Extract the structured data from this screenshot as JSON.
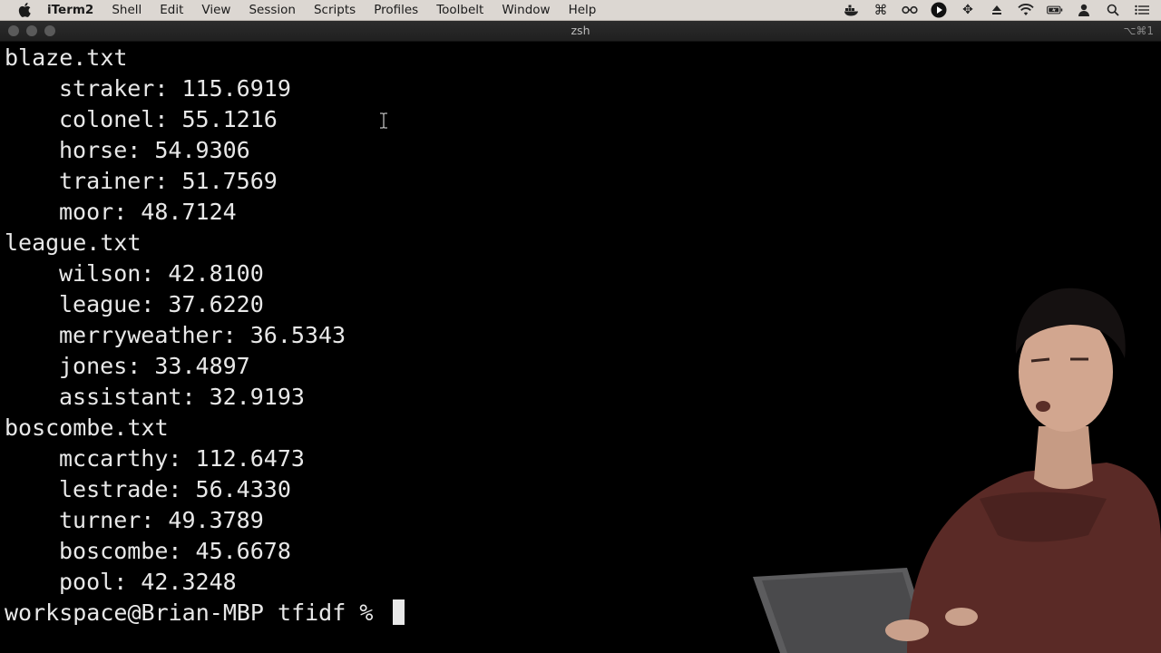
{
  "menubar": {
    "app_name": "iTerm2",
    "items": [
      "Shell",
      "Edit",
      "View",
      "Session",
      "Scripts",
      "Profiles",
      "Toolbelt",
      "Window",
      "Help"
    ],
    "status_icons": [
      "docker-icon",
      "command-icon",
      "glasses-icon",
      "play-icon",
      "move-icon",
      "eject-icon",
      "wifi-icon",
      "battery-icon",
      "user-icon",
      "search-icon",
      "list-icon"
    ]
  },
  "window": {
    "title": "zsh",
    "shortcut": "⌥⌘1"
  },
  "terminal": {
    "groups": [
      {
        "file": "blaze.txt",
        "entries": [
          "straker: 115.6919",
          "colonel: 55.1216",
          "horse: 54.9306",
          "trainer: 51.7569",
          "moor: 48.7124"
        ]
      },
      {
        "file": "league.txt",
        "entries": [
          "wilson: 42.8100",
          "league: 37.6220",
          "merryweather: 36.5343",
          "jones: 33.4897",
          "assistant: 32.9193"
        ]
      },
      {
        "file": "boscombe.txt",
        "entries": [
          "mccarthy: 112.6473",
          "lestrade: 56.4330",
          "turner: 49.3789",
          "boscombe: 45.6678",
          "pool: 42.3248"
        ]
      }
    ],
    "prompt": "workspace@Brian-MBP tfidf % "
  },
  "colors": {
    "terminal_bg": "#000000",
    "terminal_fg": "#e8e8e8",
    "menubar_bg": "#dcd7d2",
    "shirt": "#5a2a26"
  }
}
